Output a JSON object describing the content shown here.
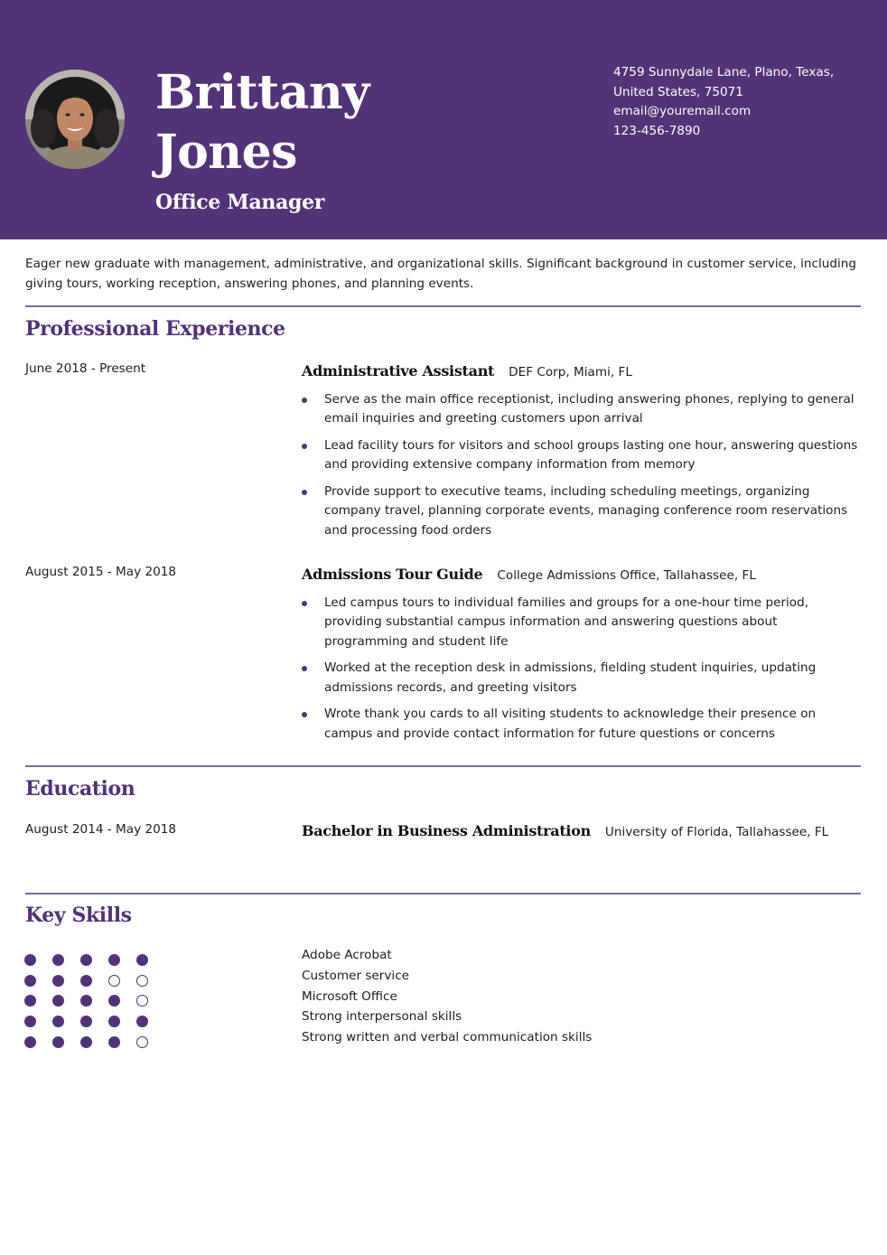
{
  "header": {
    "name_line1": "Brittany",
    "name_line2": "Jones",
    "title": "Office Manager",
    "background_color": "#523377",
    "contact": {
      "address_line1": "4759 Sunnydale Lane, Plano, Texas,",
      "address_line2": "United States, 75071",
      "email": "email@youremail.com",
      "phone": "123-456-7890"
    }
  },
  "summary": "Eager new graduate with management, administrative, and organizational skills. Significant background in customer service, including giving tours, working reception, answering phones, and planning events.",
  "accent_color": "#523377",
  "experience": {
    "title": "Professional Experience",
    "entries": [
      {
        "dates": "June 2018 - Present",
        "role": "Administrative Assistant",
        "org": "DEF Corp, Miami, FL",
        "bullets": [
          "Serve as the main office receptionist, including answering phones, replying to general email inquiries and greeting customers upon arrival",
          "Lead facility tours for visitors and school groups lasting one hour, answering questions and providing extensive company information from memory",
          "Provide support to executive teams, including scheduling meetings, organizing company travel, planning corporate events, managing conference room reservations and processing food orders"
        ]
      },
      {
        "dates": "August 2015 - May 2018",
        "role": "Admissions Tour Guide",
        "org": "College Admissions Office, Tallahassee, FL",
        "bullets": [
          "Led campus tours to individual families and groups for a one-hour time period, providing substantial campus information and answering questions about programming and student life",
          "Worked at the reception desk in admissions, fielding student inquiries, updating admissions records, and greeting visitors",
          "Wrote thank you cards to all visiting students to acknowledge their presence on campus and provide contact information for future questions or concerns"
        ]
      }
    ]
  },
  "education": {
    "title": "Education",
    "entries": [
      {
        "dates": "August 2014 - May 2018",
        "degree": "Bachelor in Business Administration",
        "school": "University of Florida, Tallahassee, FL"
      }
    ]
  },
  "skills": {
    "title": "Key Skills",
    "max_rating": 5,
    "items": [
      {
        "name": "Adobe Acrobat",
        "rating": 5
      },
      {
        "name": "Customer service",
        "rating": 3
      },
      {
        "name": "Microsoft Office",
        "rating": 4
      },
      {
        "name": "Strong interpersonal skills",
        "rating": 5
      },
      {
        "name": "Strong written and verbal communication skills",
        "rating": 4
      }
    ]
  }
}
